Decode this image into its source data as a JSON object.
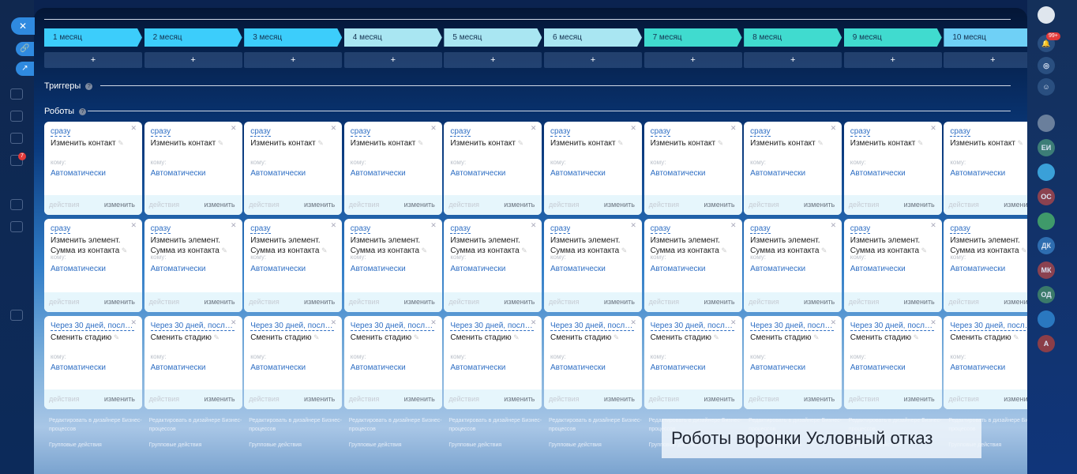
{
  "months": [
    "1 месяц",
    "2 месяц",
    "3 месяц",
    "4 месяц",
    "5 месяц",
    "6 месяц",
    "7 месяц",
    "8 месяц",
    "9 месяц",
    "10 месяц"
  ],
  "month_colors": [
    "#3ccdfb",
    "#3ccdfb",
    "#3ccdfb",
    "#a9e6f2",
    "#a9e6f2",
    "#a9e6f2",
    "#40dbcf",
    "#40dbcf",
    "#40dbcf",
    "#6fd0f6"
  ],
  "plus_label": "+",
  "triggers_title": "Триггеры",
  "robots_title": "Роботы",
  "help_label": "?",
  "robot_rows": [
    {
      "when": "сразу",
      "action": "Изменить контакт",
      "to_label": "кому:",
      "to_value": "Автоматически",
      "actions_label": "действия",
      "edit_label": "изменить"
    },
    {
      "when": "сразу",
      "action": "Изменить элемент. Сумма из контакта",
      "to_label": "кому:",
      "to_value": "Автоматически",
      "actions_label": "действия",
      "edit_label": "изменить"
    },
    {
      "when": "Через 30 дней, после ...",
      "action": "Сменить стадию",
      "to_label": "кому:",
      "to_value": "Автоматически",
      "actions_label": "действия",
      "edit_label": "изменить"
    }
  ],
  "designer_link": "Редактировать в дизайнере Бизнес-процессов",
  "group_actions": "Групповые действия",
  "caption": "Роботы воронки Условный отказ",
  "left_badge": "7",
  "right_sidebar": {
    "notifications_badge": "99+",
    "avatars": [
      {
        "initials": "",
        "color": "#6a7f9c"
      },
      {
        "initials": "ЕИ",
        "color": "#3c7d77"
      },
      {
        "initials": "",
        "color": "#3aa0d8"
      },
      {
        "initials": "ОС",
        "color": "#8b4250"
      },
      {
        "initials": "",
        "color": "#3f9a6a"
      },
      {
        "initials": "ДК",
        "color": "#2e6db0"
      },
      {
        "initials": "МК",
        "color": "#8b4250"
      },
      {
        "initials": "ОД",
        "color": "#3a7a6a"
      },
      {
        "initials": "",
        "color": "#2a78c0"
      },
      {
        "initials": "А",
        "color": "#8b3e48"
      }
    ]
  }
}
